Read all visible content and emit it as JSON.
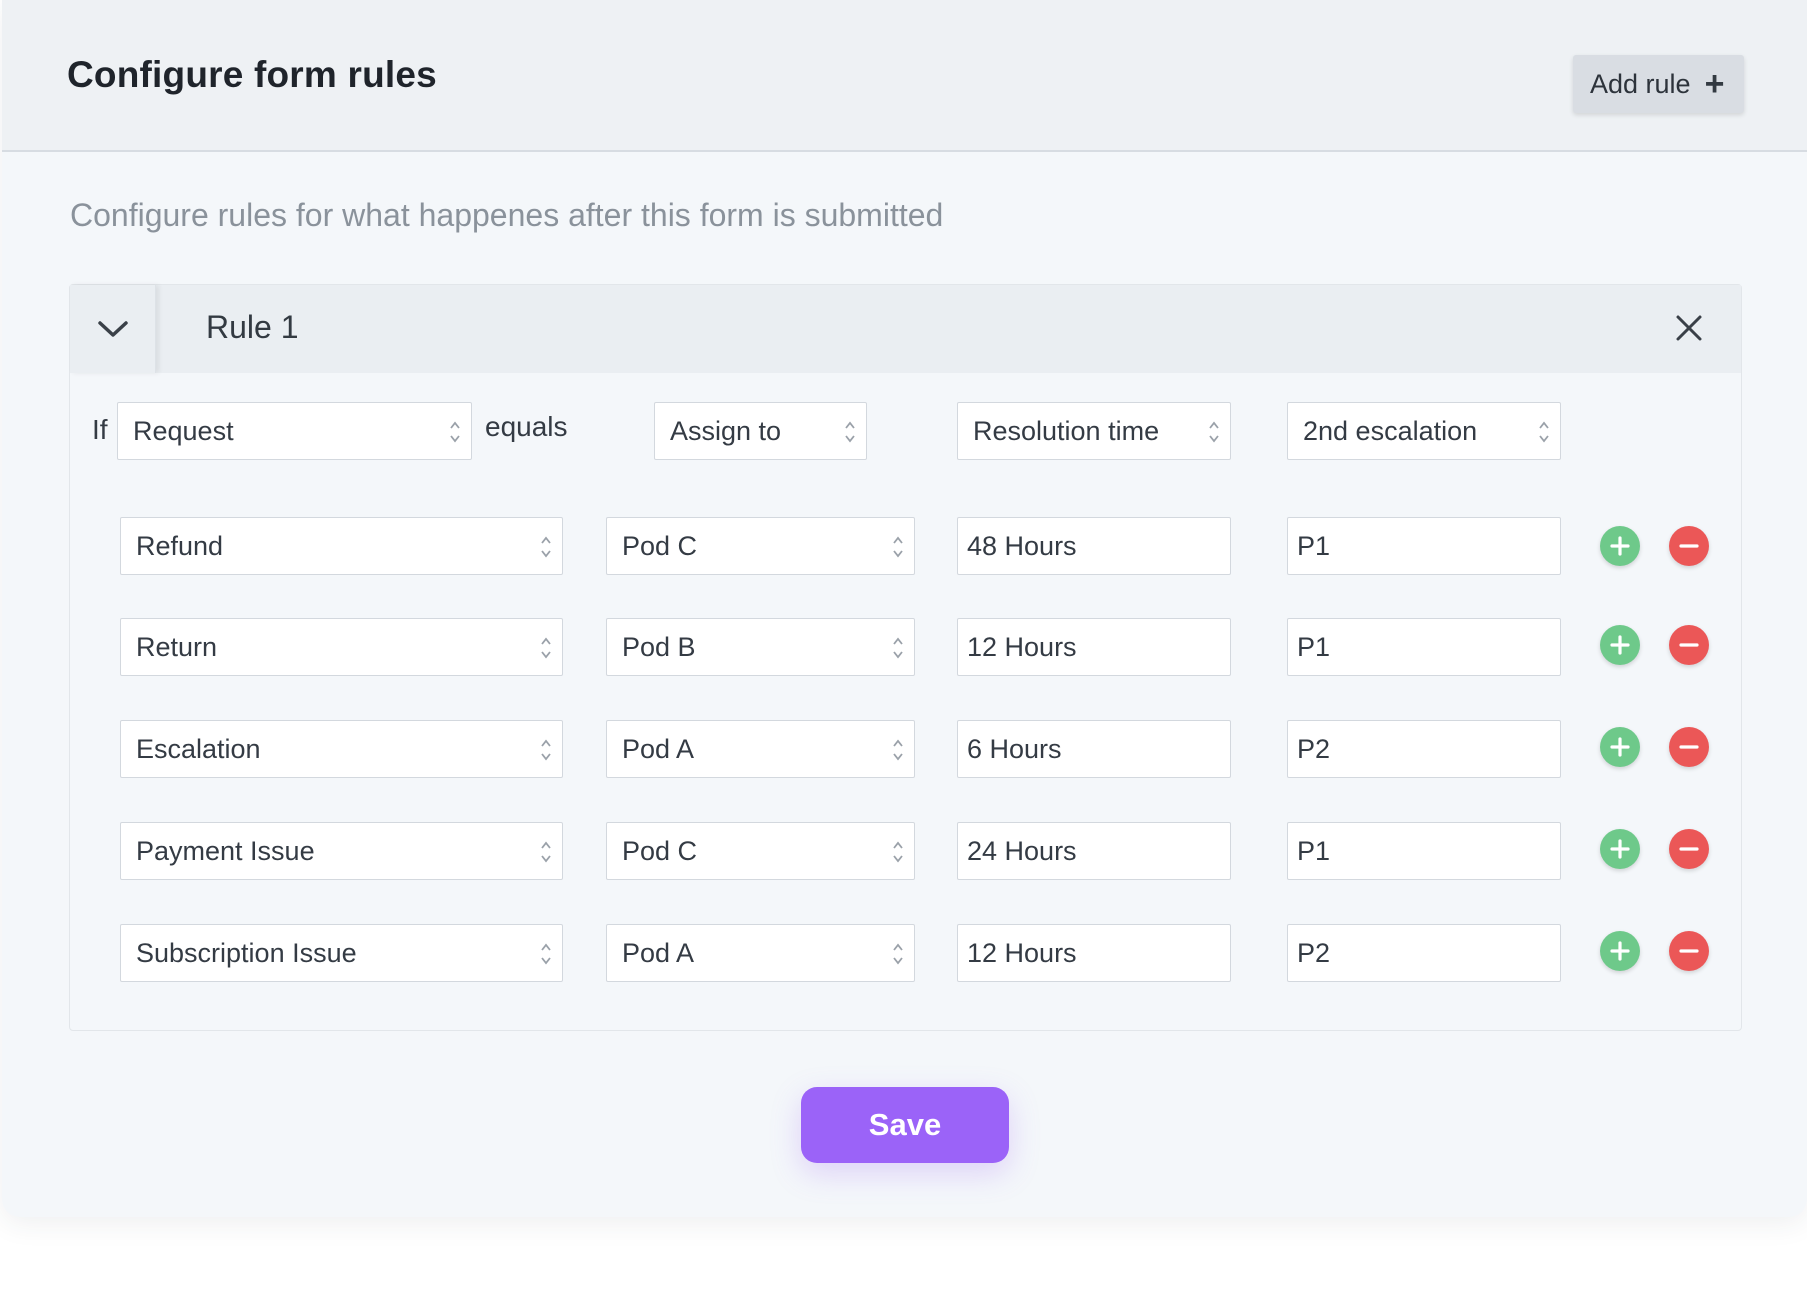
{
  "header": {
    "title": "Configure form rules",
    "add_rule_label": "Add rule",
    "add_rule_icon": "plus-icon"
  },
  "subtitle": "Configure rules for what happenes after this form is submitted",
  "rule": {
    "title": "Rule 1",
    "toggle_icon": "chevron-down-icon",
    "close_icon": "close-icon",
    "condition": {
      "if_label": "If",
      "field": "Request",
      "operator_label": "equals",
      "columns": [
        "Assign to",
        "Resolution time",
        "2nd escalation"
      ]
    },
    "rows": [
      {
        "request": "Refund",
        "assign_to": "Pod C",
        "resolution_time": "48 Hours",
        "escalation": "P1"
      },
      {
        "request": "Return",
        "assign_to": "Pod B",
        "resolution_time": "12 Hours",
        "escalation": "P1"
      },
      {
        "request": "Escalation",
        "assign_to": "Pod A",
        "resolution_time": "6 Hours",
        "escalation": "P2"
      },
      {
        "request": "Payment Issue",
        "assign_to": "Pod C",
        "resolution_time": "24 Hours",
        "escalation": "P1"
      },
      {
        "request": "Subscription Issue",
        "assign_to": "Pod A",
        "resolution_time": "12 Hours",
        "escalation": "P2"
      }
    ],
    "row_add_icon": "plus-circle-icon",
    "row_remove_icon": "minus-circle-icon"
  },
  "save_label": "Save",
  "colors": {
    "accent": "#9b63f8",
    "add": "#6ec98a",
    "remove": "#eb5757"
  }
}
